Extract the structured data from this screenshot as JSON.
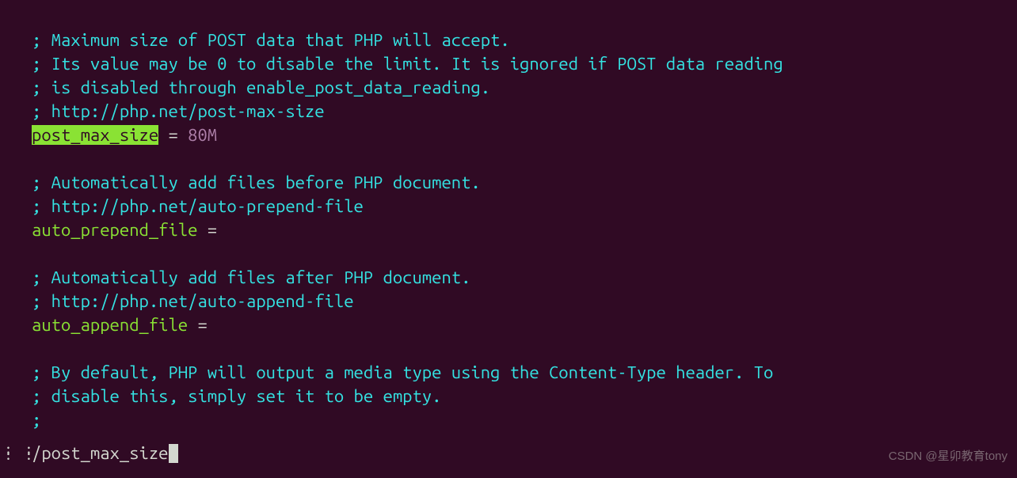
{
  "lines": {
    "c1": "; Maximum size of POST data that PHP will accept.",
    "c2": "; Its value may be 0 to disable the limit. It is ignored if POST data reading",
    "c3": "; is disabled through enable_post_data_reading.",
    "c4": "; http://php.net/post-max-size",
    "k1": "post_max_size",
    "eq": " = ",
    "v1": "80M",
    "blank": "",
    "c5": "; Automatically add files before PHP document.",
    "c6": "; http://php.net/auto-prepend-file",
    "k2": "auto_prepend_file",
    "eq2": " =",
    "c7": "; Automatically add files after PHP document.",
    "c8": "; http://php.net/auto-append-file",
    "k3": "auto_append_file",
    "eq3": " =",
    "c9": "; By default, PHP will output a media type using the Content-Type header. To",
    "c10": "; disable this, simply set it to be empty.",
    "c11": ";"
  },
  "search": {
    "prefix": "/",
    "term": "post_max_size"
  },
  "watermark": "CSDN @星卯教育tony"
}
